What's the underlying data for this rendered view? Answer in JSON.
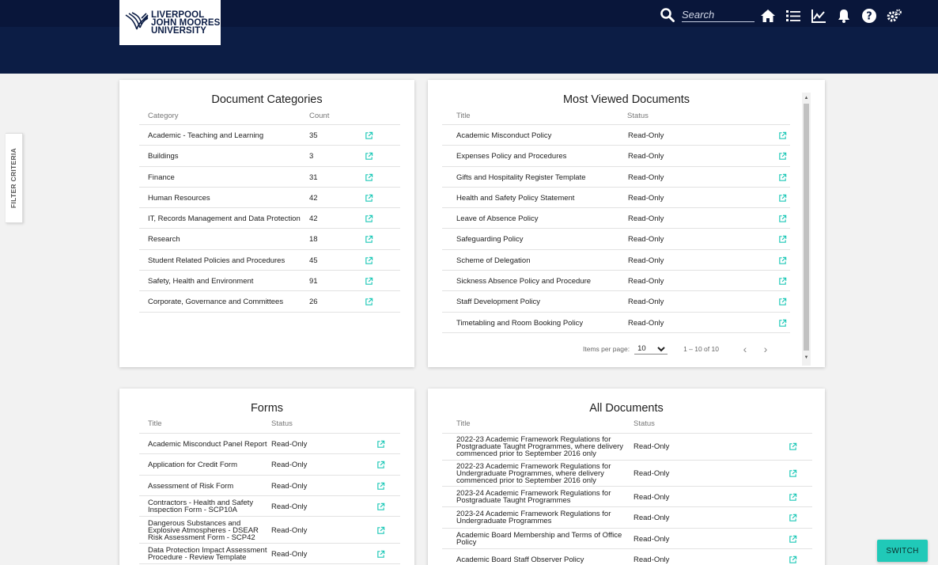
{
  "header": {
    "logo_lines": [
      "LIVERPOOL",
      "JOHN MOORES",
      "UNIVERSITY"
    ],
    "search_placeholder": "Search",
    "nav_icons": [
      "home-icon",
      "list-icon",
      "chart-icon",
      "bell-icon",
      "help-icon",
      "settings-icon"
    ],
    "colors": {
      "header_bg": "#0c1d45",
      "accent": "#20c9b8"
    }
  },
  "sidebar": {
    "filter_label": "FILTER CRITERIA"
  },
  "categories": {
    "title": "Document Categories",
    "col_category": "Category",
    "col_count": "Count",
    "rows": [
      {
        "name": "Academic - Teaching and Learning",
        "count": "35"
      },
      {
        "name": "Buildings",
        "count": "3"
      },
      {
        "name": "Finance",
        "count": "31"
      },
      {
        "name": "Human Resources",
        "count": "42"
      },
      {
        "name": "IT, Records Management and Data Protection",
        "count": "42"
      },
      {
        "name": "Research",
        "count": "18"
      },
      {
        "name": "Student Related Policies and Procedures",
        "count": "45"
      },
      {
        "name": "Safety, Health and Environment",
        "count": "91"
      },
      {
        "name": "Corporate, Governance and Committees",
        "count": "26"
      }
    ]
  },
  "most_viewed": {
    "title": "Most Viewed Documents",
    "col_title": "Title",
    "col_status": "Status",
    "rows": [
      {
        "title": "Academic Misconduct Policy",
        "status": "Read-Only"
      },
      {
        "title": "Expenses Policy and Procedures",
        "status": "Read-Only"
      },
      {
        "title": "Gifts and Hospitality Register Template",
        "status": "Read-Only"
      },
      {
        "title": "Health and Safety Policy Statement",
        "status": "Read-Only"
      },
      {
        "title": "Leave of Absence Policy",
        "status": "Read-Only"
      },
      {
        "title": "Safeguarding Policy",
        "status": "Read-Only"
      },
      {
        "title": "Scheme of Delegation",
        "status": "Read-Only"
      },
      {
        "title": "Sickness Absence Policy and Procedure",
        "status": "Read-Only"
      },
      {
        "title": "Staff Development Policy",
        "status": "Read-Only"
      },
      {
        "title": "Timetabling and Room Booking Policy",
        "status": "Read-Only"
      }
    ],
    "pager": {
      "items_per_page_label": "Items per page:",
      "items_per_page": "10",
      "range": "1 – 10 of 10"
    }
  },
  "forms": {
    "title": "Forms",
    "col_title": "Title",
    "col_status": "Status",
    "rows": [
      {
        "title": [
          "Academic Misconduct Panel Report"
        ],
        "status": "Read-Only"
      },
      {
        "title": [
          "Application for Credit Form"
        ],
        "status": "Read-Only"
      },
      {
        "title": [
          "Assessment of Risk Form"
        ],
        "status": "Read-Only"
      },
      {
        "title": [
          "Contractors - Health and Safety",
          "Inspection Form - SCP10A"
        ],
        "status": "Read-Only"
      },
      {
        "title": [
          "Dangerous Substances and",
          "Explosive Atmospheres - DSEAR",
          "Risk Assessment Form - SCP42"
        ],
        "status": "Read-Only"
      },
      {
        "title": [
          "Data Protection Impact Assessment",
          "Procedure - Review Template"
        ],
        "status": "Read-Only"
      }
    ]
  },
  "all_documents": {
    "title": "All Documents",
    "col_title": "Title",
    "col_status": "Status",
    "rows": [
      {
        "title": [
          "2022-23 Academic Framework Regulations for",
          "Postgraduate Taught Programmes, where delivery",
          "commenced prior to September 2016 only"
        ],
        "status": "Read-Only"
      },
      {
        "title": [
          "2022-23 Academic Framework Regulations for",
          "Undergraduate Programmes, where delivery",
          "commenced prior to September 2016 only"
        ],
        "status": "Read-Only"
      },
      {
        "title": [
          "2023-24 Academic Framework Regulations for",
          "Postgraduate Taught Programmes"
        ],
        "status": "Read-Only"
      },
      {
        "title": [
          "2023-24 Academic Framework Regulations for",
          "Undergraduate Programmes"
        ],
        "status": "Read-Only"
      },
      {
        "title": [
          "Academic Board Membership and Terms of Office",
          "Policy"
        ],
        "status": "Read-Only"
      },
      {
        "title": [
          "Academic Board Staff Observer Policy"
        ],
        "status": "Read-Only"
      }
    ]
  },
  "switch_label": "SWITCH"
}
